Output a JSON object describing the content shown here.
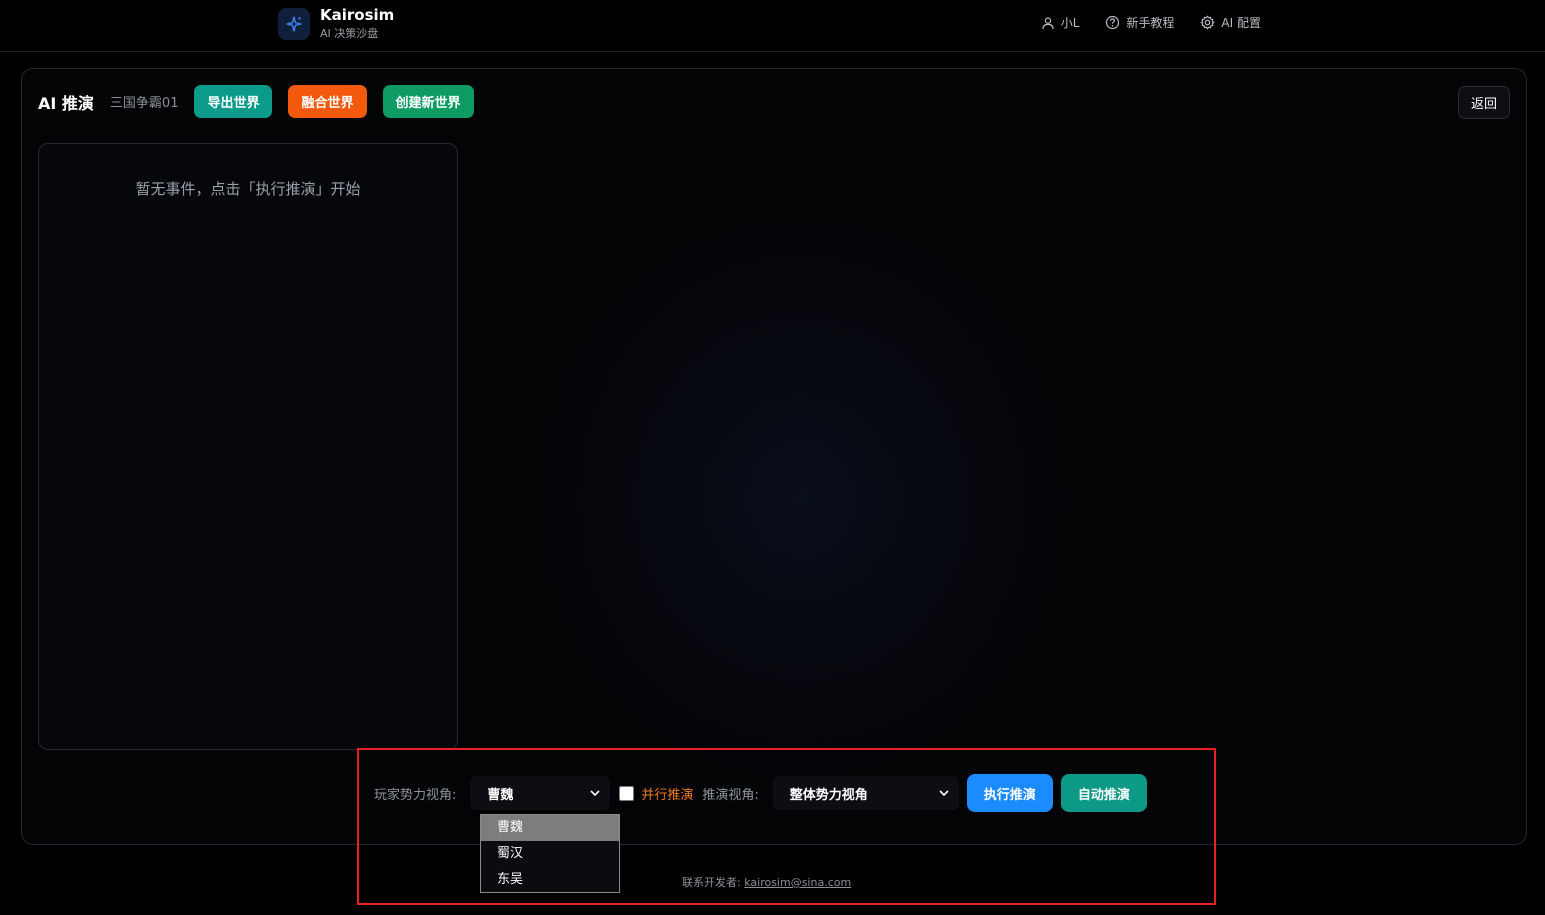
{
  "app": {
    "name": "Kairosim",
    "subtitle": "AI 决策沙盘"
  },
  "nav": {
    "user": "小L",
    "tutorial": "新手教程",
    "ai_config": "AI 配置"
  },
  "header": {
    "title": "AI 推演",
    "world_name": "三国争霸01",
    "export_label": "导出世界",
    "merge_label": "融合世界",
    "create_label": "创建新世界",
    "back_label": "返回"
  },
  "events": {
    "empty_text": "暂无事件，点击「执行推演」开始"
  },
  "controls": {
    "faction_label": "玩家势力视角:",
    "faction_selected": "曹魏",
    "faction_options": [
      "曹魏",
      "蜀汉",
      "东吴"
    ],
    "parallel_label": "并行推演",
    "parallel_checked": false,
    "view_label": "推演视角:",
    "view_selected": "整体势力视角",
    "run_label": "执行推演",
    "auto_label": "自动推演"
  },
  "footer": {
    "contact_label": "联系开发者:",
    "contact_email": "kairosim@sina.com"
  },
  "colors": {
    "export": "#0c9a8a",
    "merge": "#f2590d",
    "create": "#0d9a63",
    "run": "#1a8cff",
    "auto": "#0c9a86",
    "parallel_label": "#f07a1f",
    "highlight": "#e82020"
  },
  "icons": {
    "logo": "sparkle-icon",
    "user": "user-icon",
    "tutorial": "help-circle-icon",
    "ai_config": "gear-icon",
    "dropdown": "chevron-down-icon"
  }
}
